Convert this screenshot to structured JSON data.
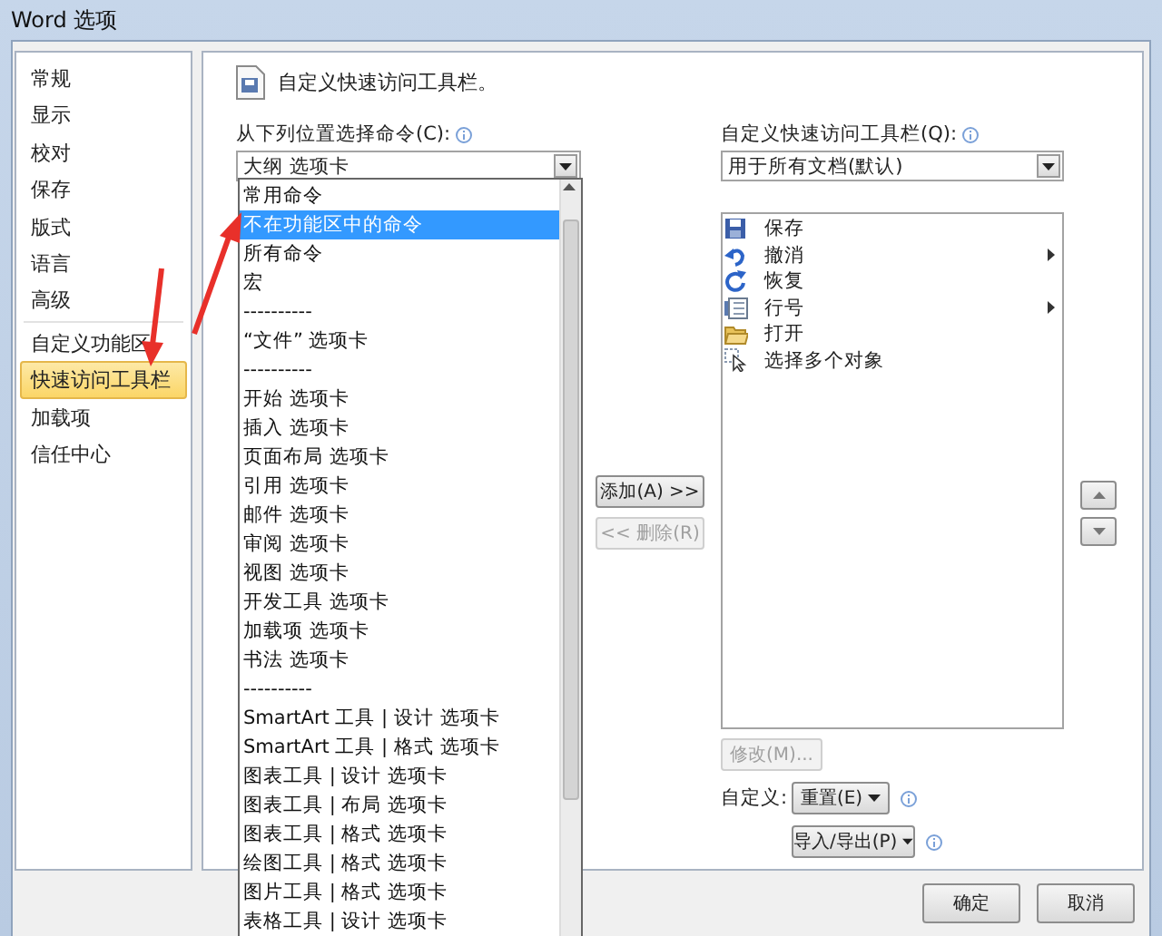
{
  "window": {
    "title": "Word 选项"
  },
  "sidebar": {
    "items": [
      {
        "label": "常规",
        "selected": false
      },
      {
        "label": "显示",
        "selected": false
      },
      {
        "label": "校对",
        "selected": false
      },
      {
        "label": "保存",
        "selected": false
      },
      {
        "label": "版式",
        "selected": false
      },
      {
        "label": "语言",
        "selected": false
      },
      {
        "label": "高级",
        "selected": false
      },
      {
        "label": "自定义功能区",
        "selected": false
      },
      {
        "label": "快速访问工具栏",
        "selected": true
      },
      {
        "label": "加载项",
        "selected": false
      },
      {
        "label": "信任中心",
        "selected": false
      }
    ]
  },
  "header": {
    "text": "自定义快速访问工具栏。"
  },
  "commands_from": {
    "label": "从下列位置选择命令(C):",
    "value": "大纲 选项卡",
    "dropdown": {
      "items": [
        {
          "label": "常用命令",
          "selected": false
        },
        {
          "label": "不在功能区中的命令",
          "selected": true
        },
        {
          "label": "所有命令",
          "selected": false
        },
        {
          "label": "宏",
          "selected": false
        },
        {
          "label": "----------",
          "selected": false
        },
        {
          "label": "“文件” 选项卡",
          "selected": false
        },
        {
          "label": "----------",
          "selected": false
        },
        {
          "label": "开始 选项卡",
          "selected": false
        },
        {
          "label": "插入 选项卡",
          "selected": false
        },
        {
          "label": "页面布局 选项卡",
          "selected": false
        },
        {
          "label": "引用 选项卡",
          "selected": false
        },
        {
          "label": "邮件 选项卡",
          "selected": false
        },
        {
          "label": "审阅 选项卡",
          "selected": false
        },
        {
          "label": "视图 选项卡",
          "selected": false
        },
        {
          "label": "开发工具 选项卡",
          "selected": false
        },
        {
          "label": "加载项 选项卡",
          "selected": false
        },
        {
          "label": "书法 选项卡",
          "selected": false
        },
        {
          "label": "----------",
          "selected": false
        },
        {
          "label": "SmartArt 工具 | 设计 选项卡",
          "selected": false
        },
        {
          "label": "SmartArt 工具 | 格式 选项卡",
          "selected": false
        },
        {
          "label": "图表工具 | 设计 选项卡",
          "selected": false
        },
        {
          "label": "图表工具 | 布局 选项卡",
          "selected": false
        },
        {
          "label": "图表工具 | 格式 选项卡",
          "selected": false
        },
        {
          "label": "绘图工具 | 格式 选项卡",
          "selected": false
        },
        {
          "label": "图片工具 | 格式 选项卡",
          "selected": false
        },
        {
          "label": "表格工具 | 设计 选项卡",
          "selected": false
        }
      ]
    }
  },
  "add_button": {
    "label": "添加(A) >>",
    "disabled": false
  },
  "remove_button": {
    "label": "<< 删除(R)",
    "disabled": true
  },
  "toolbar_scope": {
    "label": "自定义快速访问工具栏(Q):",
    "value": "用于所有文档(默认)"
  },
  "toolbar_items": [
    {
      "label": "保存",
      "kind": "save",
      "submenu": false
    },
    {
      "label": "撤消",
      "kind": "undo",
      "submenu": true
    },
    {
      "label": "恢复",
      "kind": "redo",
      "submenu": false
    },
    {
      "label": "行号",
      "kind": "page",
      "submenu": true
    },
    {
      "label": "打开",
      "kind": "folder",
      "submenu": false
    },
    {
      "label": "选择多个对象",
      "kind": "pointer",
      "submenu": false
    }
  ],
  "modify_button": {
    "label": "修改(M)...",
    "disabled": true
  },
  "customize": {
    "label": "自定义:",
    "reset_button": "重置(E)",
    "import_export_button": "导入/导出(P)"
  },
  "buttons": [
    "确定",
    "取消"
  ]
}
